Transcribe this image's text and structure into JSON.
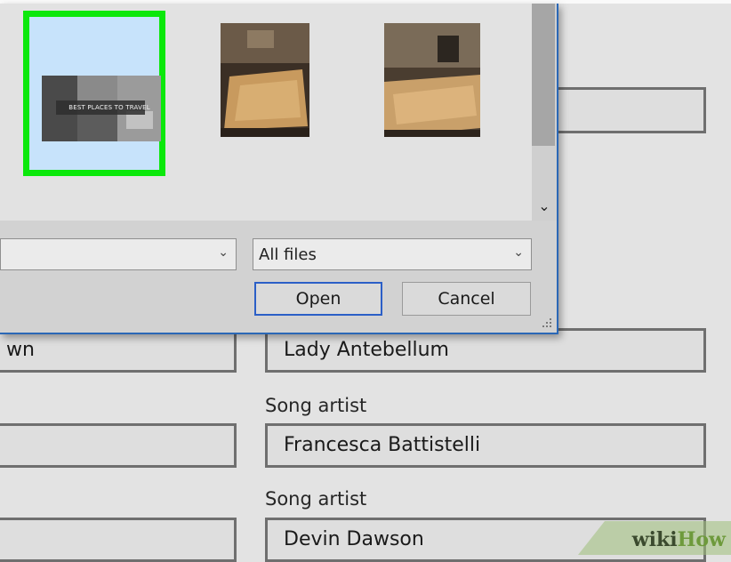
{
  "dialog": {
    "filename_value": "",
    "filetype_value": "All files",
    "open_label": "Open",
    "cancel_label": "Cancel",
    "thumbnail_caption": "BEST PLACES TO TRAVEL"
  },
  "form": {
    "left_col_row1_value": "wn",
    "right_col_row1_value": "Lady Antebellum",
    "row2_label": "Song artist",
    "right_col_row2_value": "Francesca Battistelli",
    "row3_label": "Song artist",
    "right_col_row3_value": "Devin Dawson"
  },
  "watermark": {
    "part1": "wiki",
    "part2": "How"
  },
  "colors": {
    "selection_border": "#0be80b",
    "selection_fill": "#c7e3fb",
    "dialog_accent": "#2b68b6",
    "primary_button_border": "#2b5fc7"
  },
  "icons": [
    "chevron-down-icon",
    "resize-grip-icon"
  ]
}
